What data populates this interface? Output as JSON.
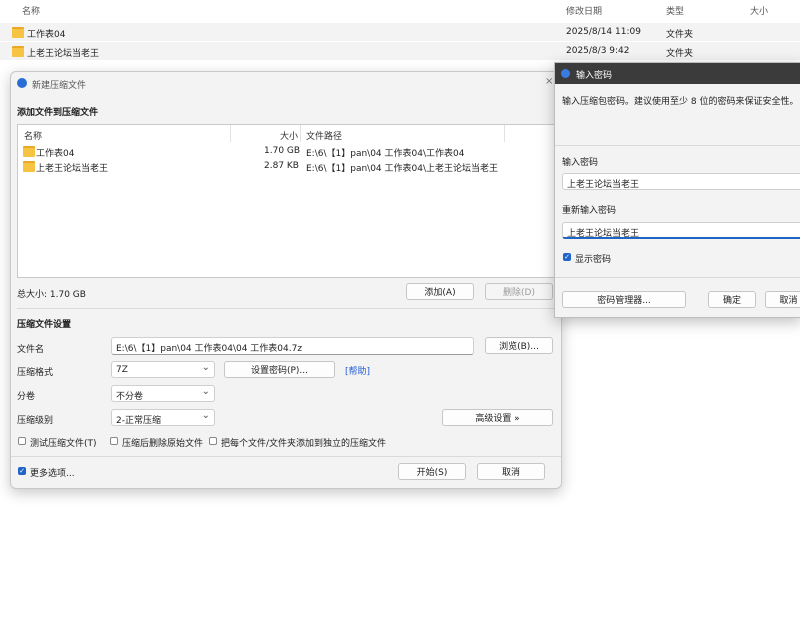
{
  "explorer": {
    "headers": [
      "名称",
      "修改日期",
      "类型",
      "大小"
    ],
    "rows": [
      {
        "name": "工作表04",
        "date": "2025/8/14 11:09",
        "type": "文件夹"
      },
      {
        "name": "上老王论坛当老王",
        "date": "2025/8/3 9:42",
        "type": "文件夹"
      }
    ]
  },
  "dialog": {
    "title": "新建压缩文件",
    "section_add": "添加文件到压缩文件",
    "list_headers": [
      "名称",
      "大小",
      "文件路径"
    ],
    "list_rows": [
      {
        "name": "工作表04",
        "size": "1.70 GB",
        "path": "E:\\6\\【1】pan\\04 工作表04\\工作表04"
      },
      {
        "name": "上老王论坛当老王",
        "size": "2.87 KB",
        "path": "E:\\6\\【1】pan\\04 工作表04\\上老王论坛当老王"
      }
    ],
    "total_size": "总大小: 1.70 GB",
    "add_button": "添加(A)",
    "delete_button": "删除(D)",
    "section_settings": "压缩文件设置",
    "filename_label": "文件名",
    "filename_value": "E:\\6\\【1】pan\\04 工作表04\\04 工作表04.7z",
    "browse_button": "浏览(B)...",
    "format_label": "压缩格式",
    "format_value": "7Z",
    "set_password_button": "设置密码(P)...",
    "help_link": "[帮助]",
    "volume_label": "分卷",
    "volume_value": "不分卷",
    "level_label": "压缩级别",
    "level_value": "2-正常压缩",
    "advanced_button": "高级设置 »",
    "check_test": "测试压缩文件(T)",
    "check_delete": "压缩后删除原始文件",
    "check_separate": "把每个文件/文件夹添加到独立的压缩文件",
    "more_options": "更多选项...",
    "start_button": "开始(S)",
    "cancel_button": "取消"
  },
  "password_dialog": {
    "title": "输入密码",
    "description": "输入压缩包密码。建议使用至少 8 位的密码来保证安全性。",
    "password_label": "输入密码",
    "password_value": "上老王论坛当老王",
    "confirm_label": "重新输入密码",
    "confirm_value": "上老王论坛当老王",
    "show_password": "显示密码",
    "manager_button": "密码管理器...",
    "ok_button": "确定",
    "cancel_button": "取消"
  }
}
